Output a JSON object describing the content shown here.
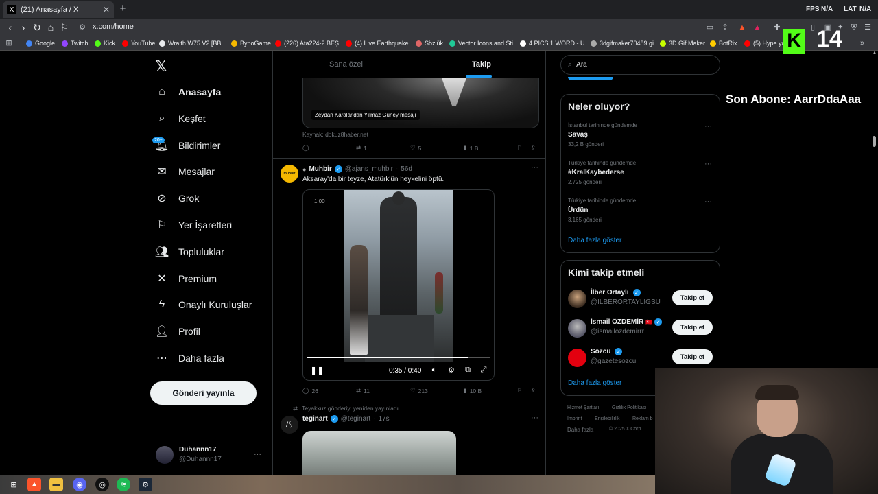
{
  "browser": {
    "tab_title": "(21) Anasayfa / X",
    "tab_icon_glyph": "X",
    "new_tab_glyph": "+",
    "url": "x.com/home",
    "overlay_fps": "FPS",
    "overlay_fps_val": "N/A",
    "overlay_lat": "LAT",
    "overlay_lat_val": "N/A",
    "bookmarks": [
      {
        "label": "Google",
        "color": "#4285f4"
      },
      {
        "label": "Twitch",
        "color": "#9146ff"
      },
      {
        "label": "Kick",
        "color": "#53fc18"
      },
      {
        "label": "YouTube",
        "color": "#ff0000"
      },
      {
        "label": "Wraith W75 V2 [BBL...",
        "color": "#e8eaed"
      },
      {
        "label": "BynoGame",
        "color": "#f5b800"
      },
      {
        "label": "(226) Ata224-2 BEŞ...",
        "color": "#ff0000"
      },
      {
        "label": "(4) Live Earthquake...",
        "color": "#ff0000"
      },
      {
        "label": "Sözlük",
        "color": "#e06666"
      },
      {
        "label": "Vector Icons and Sti...",
        "color": "#20c997"
      },
      {
        "label": "4 PICS 1 WORD - Ü...",
        "color": "#ffffff"
      },
      {
        "label": "3dgifmaker70489.gi...",
        "color": "#aaaaaa"
      },
      {
        "label": "3D Gif Maker",
        "color": "#c6ff00"
      },
      {
        "label": "BotRix",
        "color": "#ffcc00"
      },
      {
        "label": "(5) Hype yayın",
        "color": "#ff0000"
      }
    ]
  },
  "stream_overlay": {
    "kick_letter": "K",
    "kick_number": "14",
    "son_abone": "Son Abone: AarrDdaAaa"
  },
  "nav": {
    "logo_glyph": "𝕏",
    "badge": "20+",
    "items": [
      {
        "label": "Anasayfa",
        "icon": "home-icon",
        "glyph": "⌂"
      },
      {
        "label": "Keşfet",
        "icon": "search-icon",
        "glyph": "⌕"
      },
      {
        "label": "Bildirimler",
        "icon": "bell-icon",
        "glyph": "🔔︎"
      },
      {
        "label": "Mesajlar",
        "icon": "envelope-icon",
        "glyph": "✉"
      },
      {
        "label": "Grok",
        "icon": "grok-icon",
        "glyph": "⊘"
      },
      {
        "label": "Yer İşaretleri",
        "icon": "bookmark-icon",
        "glyph": "⚐"
      },
      {
        "label": "Topluluklar",
        "icon": "communities-icon",
        "glyph": "👥︎"
      },
      {
        "label": "Premium",
        "icon": "x-premium-icon",
        "glyph": "✕"
      },
      {
        "label": "Onaylı Kuruluşlar",
        "icon": "lightning-icon",
        "glyph": "ϟ"
      },
      {
        "label": "Profil",
        "icon": "person-icon",
        "glyph": "👤︎"
      },
      {
        "label": "Daha fazla",
        "icon": "more-circle-icon",
        "glyph": "⋯"
      }
    ],
    "post_button": "Gönderi yayınla",
    "account_name": "Duhannn17",
    "account_handle": "@Duhannn17",
    "more_glyph": "···"
  },
  "timeline": {
    "tab_for_you": "Sana özel",
    "tab_following": "Takip",
    "post1": {
      "caption": "Zeydan Karalar'dan Yılmaz Güney mesajı",
      "source": "Kaynak: dokuz8haber.net",
      "replies": "",
      "reposts": "1",
      "likes": "5",
      "views": "1 B"
    },
    "post2": {
      "avatar_text": "muhbir",
      "name": "Muhbir",
      "handle": "@ajans_muhbir",
      "time": "56d",
      "text": "Aksaray'da bir teyze, Atatürk'ün heykelini öptü.",
      "video_ratio": "1.00",
      "video_time": "0:35 / 0:40",
      "video_progress": 0.875,
      "replies": "26",
      "reposts": "11",
      "likes": "213",
      "views": "10 B"
    },
    "post3": {
      "repost_note": "Teyakkuz gönderiyi yeniden yayınladı",
      "name": "teginart",
      "handle": "@teginart",
      "time": "17s",
      "avatar_glyph": "/ᛊ"
    }
  },
  "sidebar": {
    "search_placeholder": "Ara",
    "trends_title": "Neler oluyor?",
    "trends": [
      {
        "meta": "İstanbul tarihinde gündemde",
        "name": "Savaş",
        "count": "33,2 B gönderi"
      },
      {
        "meta": "Türkiye tarihinde gündemde",
        "name": "#KralKaybederse",
        "count": "2.725 gönderi"
      },
      {
        "meta": "Türkiye tarihinde gündemde",
        "name": "Ürdün",
        "count": "3.165 gönderi"
      }
    ],
    "show_more": "Daha fazla göster",
    "wtf_title": "Kimi takip etmeli",
    "who_to_follow": [
      {
        "name": "İlber Ortaylı",
        "handle": "@ILBERORTAYLIGSU",
        "button": "Takip et",
        "flag": ""
      },
      {
        "name": "İsmail ÖZDEMİR",
        "handle": "@ismailozdemirrr",
        "button": "Takip et",
        "flag": "🇹🇷"
      },
      {
        "name": "Sözcü",
        "handle": "@gazetesozcu",
        "button": "Takip et",
        "flag": ""
      }
    ],
    "wtf_show_more": "Daha fazla göster",
    "footer": [
      "Hizmet Şartları",
      "Gizlilik Politikası",
      "Imprint",
      "Erişilebilirlik",
      "Reklam b",
      "Daha fazla ···",
      "© 2025 X Corp."
    ]
  }
}
